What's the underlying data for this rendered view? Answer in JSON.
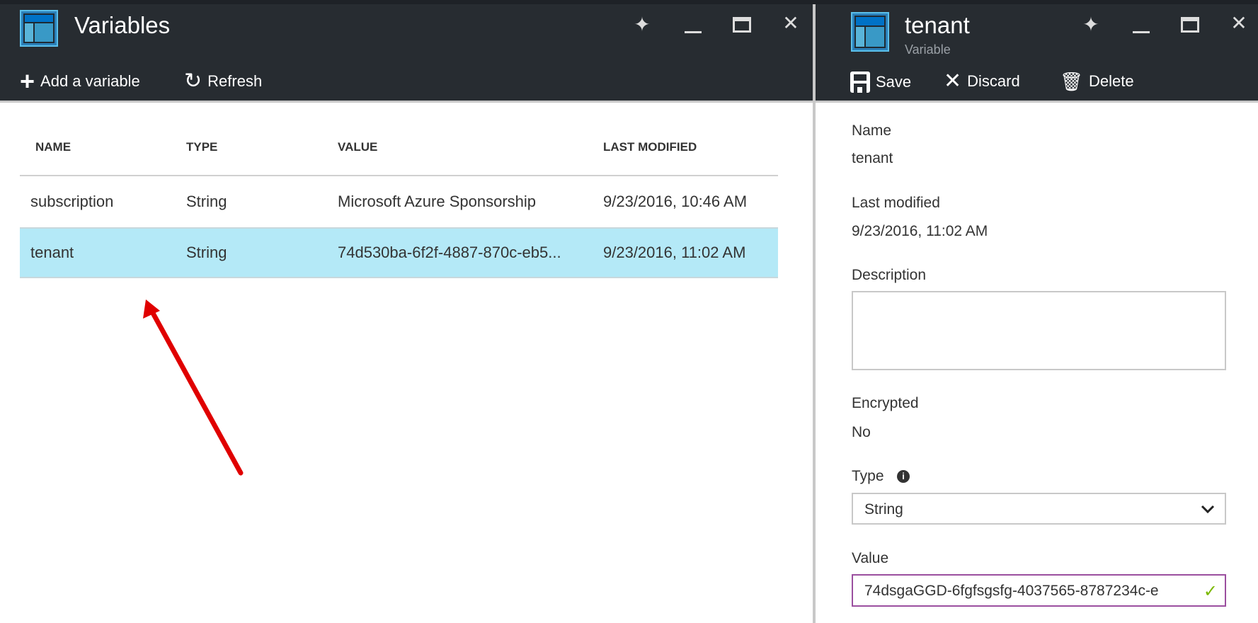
{
  "left_blade": {
    "title": "Variables",
    "toolbar": {
      "add": "Add a variable",
      "refresh": "Refresh"
    },
    "columns": [
      "NAME",
      "TYPE",
      "VALUE",
      "LAST MODIFIED"
    ],
    "rows": [
      {
        "name": "subscription",
        "type": "String",
        "value": "Microsoft Azure Sponsorship",
        "modified": "9/23/2016, 10:46 AM"
      },
      {
        "name": "tenant",
        "type": "String",
        "value": "74d530ba-6f2f-4887-870c-eb5...",
        "modified": "9/23/2016, 11:02 AM"
      }
    ]
  },
  "right_blade": {
    "title": "tenant",
    "subtitle": "Variable",
    "toolbar": {
      "save": "Save",
      "discard": "Discard",
      "delete": "Delete"
    },
    "name_label": "Name",
    "name_value": "tenant",
    "modified_label": "Last modified",
    "modified_value": "9/23/2016, 11:02 AM",
    "description_label": "Description",
    "description_value": "",
    "encrypted_label": "Encrypted",
    "encrypted_value": "No",
    "type_label": "Type",
    "type_value": "String",
    "value_label": "Value",
    "value_value": "74dsgaGGD-6fgfsgsfg-4037565-8787234c-e"
  },
  "colors": {
    "selected_row": "#b4e9f7",
    "header": "#272c31",
    "arrow": "#e00000",
    "value_border": "#9b4f9f",
    "check": "#7ab800"
  }
}
